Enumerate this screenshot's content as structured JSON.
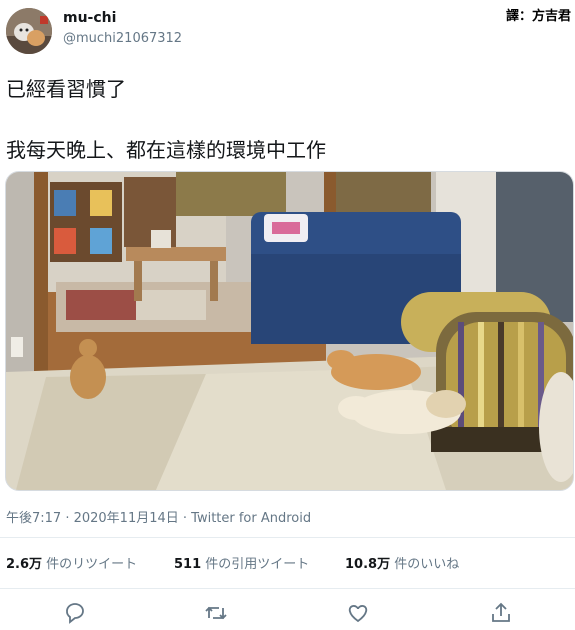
{
  "tweet": {
    "display_name": "mu-chi",
    "handle": "@muchi21067312",
    "credit": "譯：方吉君",
    "text_line1": "已經看習慣了",
    "text_line2": "我每天晚上、都在這樣的環境中工作",
    "meta": "午後7:17 · 2020年11月14日 · Twitter for Android"
  },
  "stats": [
    {
      "count": "2.6万",
      "label": "件のリツイート"
    },
    {
      "count": "511",
      "label": "件の引用ツイート"
    },
    {
      "count": "10.8万",
      "label": "件のいいね"
    }
  ],
  "actions": [
    "reply-icon",
    "retweet-icon",
    "like-icon",
    "share-icon"
  ],
  "colors": {
    "secondary_text": "#657786",
    "divider": "#e6ecf0",
    "sofa": "#2e4f86"
  }
}
